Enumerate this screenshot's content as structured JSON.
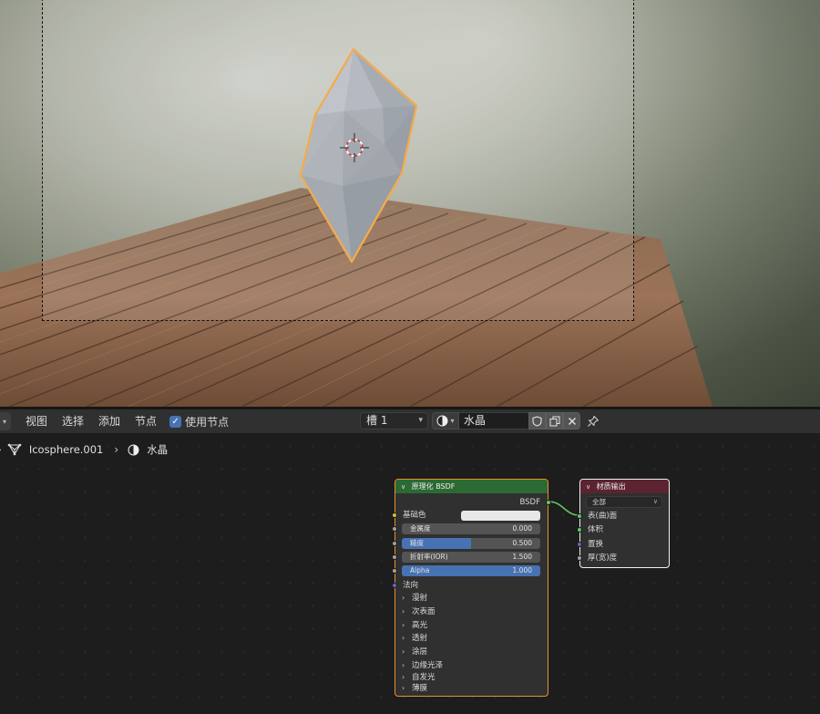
{
  "header": {
    "menu": [
      "视图",
      "选择",
      "添加",
      "节点"
    ],
    "use_nodes_label": "使用节点",
    "slot_label": "槽 1",
    "material_name": "水晶"
  },
  "breadcrumb": {
    "object_name": "Icosphere.001",
    "material_name": "水晶"
  },
  "node_bsdf": {
    "title": "原理化 BSDF",
    "output_label": "BSDF",
    "base_color_label": "基础色",
    "base_color": "#e8e8e8",
    "metallic": {
      "label": "金属度",
      "value": "0.000",
      "fraction": 0.0
    },
    "roughness": {
      "label": "糙度",
      "value": "0.500",
      "fraction": 0.5
    },
    "ior": {
      "label": "折射率(IOR)",
      "value": "1.500",
      "fraction": 0.0
    },
    "alpha": {
      "label": "Alpha",
      "value": "1.000",
      "fraction": 1.0
    },
    "normal_label": "法向",
    "sections": [
      "漫射",
      "次表面",
      "高光",
      "透射",
      "涂层",
      "边缘光泽",
      "自发光",
      "薄膜"
    ]
  },
  "node_output": {
    "title": "材质输出",
    "target": "全部",
    "inputs": [
      "表(曲)面",
      "体积",
      "置换",
      "厚(宽)度"
    ]
  },
  "colors": {
    "selection_outline": "#f2a23a",
    "active_node_border": "#e98e2d",
    "shader_header": "#2c6a33",
    "output_header": "#5b2430",
    "accent": "#4772b3"
  }
}
